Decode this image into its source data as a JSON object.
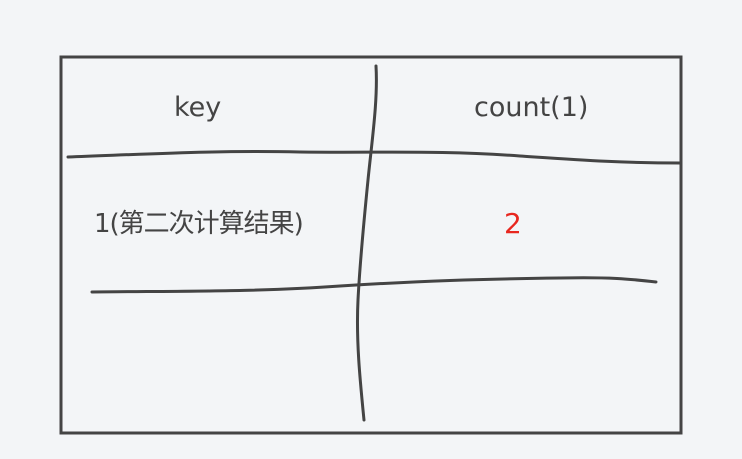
{
  "table": {
    "headers": {
      "key": "key",
      "count": "count(1)"
    },
    "rows": [
      {
        "key": "1(第二次计算结果)",
        "count": "2"
      }
    ]
  },
  "colors": {
    "background": "#f3f5f7",
    "stroke": "#444444",
    "highlight_value": "#e8271f"
  }
}
